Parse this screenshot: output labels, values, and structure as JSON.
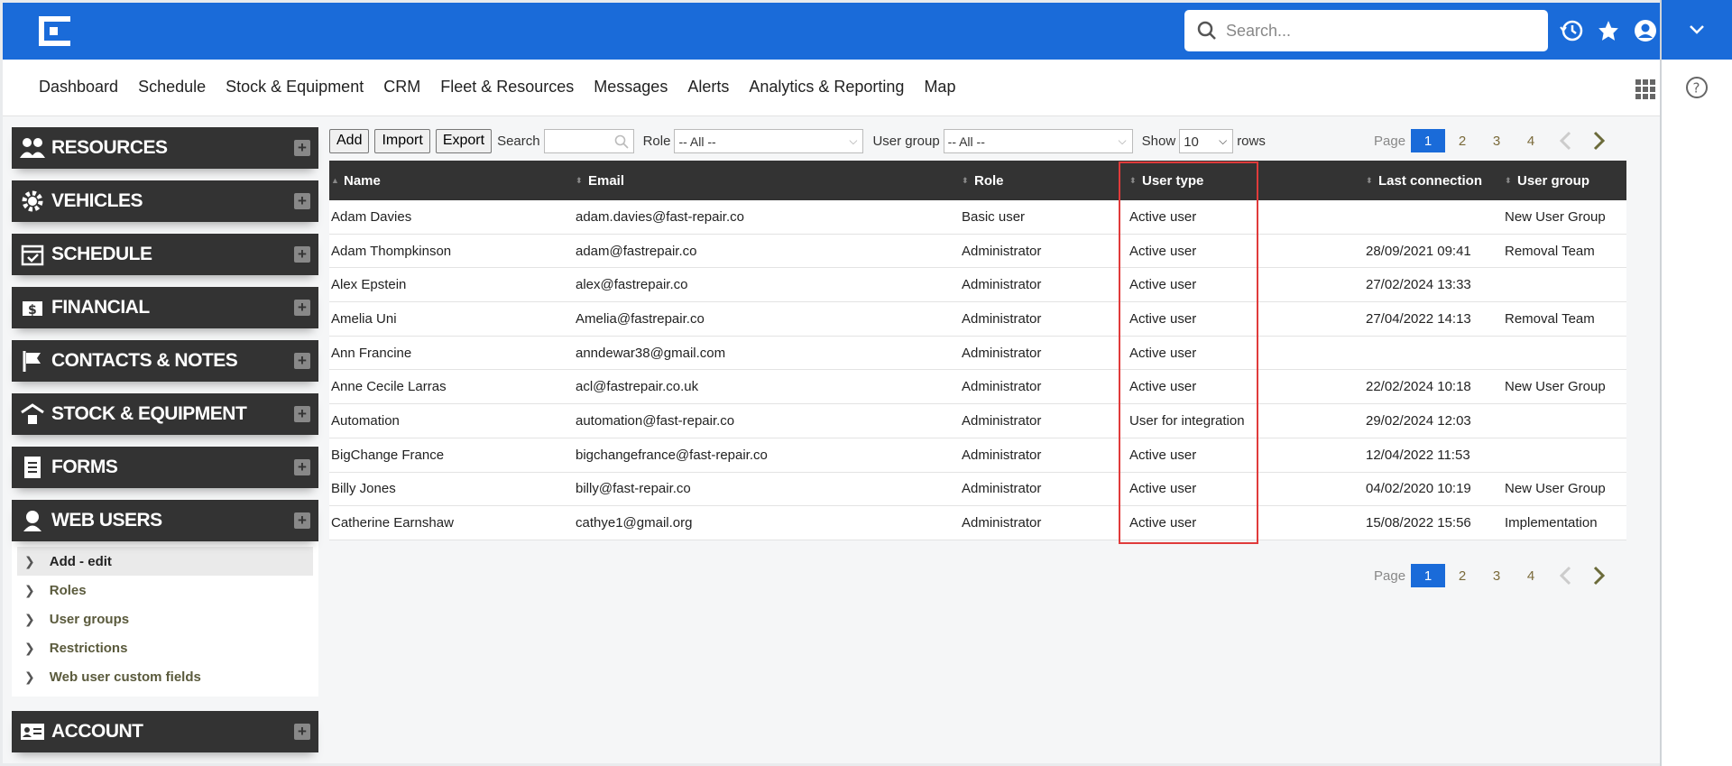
{
  "search": {
    "placeholder": "Search..."
  },
  "menu": [
    "Dashboard",
    "Schedule",
    "Stock & Equipment",
    "CRM",
    "Fleet & Resources",
    "Messages",
    "Alerts",
    "Analytics & Reporting",
    "Map"
  ],
  "sidebar": {
    "sections": [
      {
        "label": "RESOURCES",
        "icon": "people-icon"
      },
      {
        "label": "VEHICLES",
        "icon": "gear-icon"
      },
      {
        "label": "SCHEDULE",
        "icon": "calendar-icon"
      },
      {
        "label": "FINANCIAL",
        "icon": "money-icon"
      },
      {
        "label": "CONTACTS & NOTES",
        "icon": "flag-icon"
      },
      {
        "label": "STOCK & EQUIPMENT",
        "icon": "warehouse-icon"
      },
      {
        "label": "FORMS",
        "icon": "document-icon"
      },
      {
        "label": "WEB USERS",
        "icon": "user-icon"
      },
      {
        "label": "ACCOUNT",
        "icon": "id-card-icon"
      }
    ],
    "web_users_items": [
      "Add - edit",
      "Roles",
      "User groups",
      "Restrictions",
      "Web user custom fields"
    ]
  },
  "toolbar": {
    "add": "Add",
    "import": "Import",
    "export": "Export",
    "search_label": "Search",
    "role_label": "Role",
    "role_value": "-- All --",
    "group_label": "User group",
    "group_value": "-- All --",
    "show_label": "Show",
    "rows_value": "10",
    "rows_label": "rows"
  },
  "pager": {
    "label": "Page",
    "pages": [
      "1",
      "2",
      "3",
      "4"
    ],
    "current": "1"
  },
  "table": {
    "headers": [
      "Name",
      "Email",
      "Role",
      "User type",
      "Last connection",
      "User group"
    ],
    "rows": [
      [
        "Adam Davies",
        "adam.davies@fast-repair.co",
        "Basic user",
        "Active user",
        "",
        "New User Group"
      ],
      [
        "Adam Thompkinson",
        "adam@fastrepair.co",
        "Administrator",
        "Active user",
        "28/09/2021 09:41",
        "Removal Team"
      ],
      [
        "Alex Epstein",
        "alex@fastrepair.co",
        "Administrator",
        "Active user",
        "27/02/2024 13:33",
        ""
      ],
      [
        "Amelia Uni",
        "Amelia@fastrepair.co",
        "Administrator",
        "Active user",
        "27/04/2022 14:13",
        "Removal Team"
      ],
      [
        "Ann Francine",
        "anndewar38@gmail.com",
        "Administrator",
        "Active user",
        "",
        ""
      ],
      [
        "Anne Cecile Larras",
        "acl@fastrepair.co.uk",
        "Administrator",
        "Active user",
        "22/02/2024 10:18",
        "New User Group"
      ],
      [
        "Automation",
        "automation@fast-repair.co",
        "Administrator",
        "User for integration",
        "29/02/2024 12:03",
        ""
      ],
      [
        "BigChange France",
        "bigchangefrance@fast-repair.co",
        "Administrator",
        "Active user",
        "12/04/2022 11:53",
        ""
      ],
      [
        "Billy Jones",
        "billy@fast-repair.co",
        "Administrator",
        "Active user",
        "04/02/2020 10:19",
        "New User Group"
      ],
      [
        "Catherine Earnshaw",
        "cathye1@gmail.org",
        "Administrator",
        "Active user",
        "15/08/2022 15:56",
        "Implementation"
      ]
    ]
  },
  "colors": {
    "brand_blue": "#1a6bd9",
    "header_dark": "#333333",
    "highlight": "#e03b3b"
  }
}
